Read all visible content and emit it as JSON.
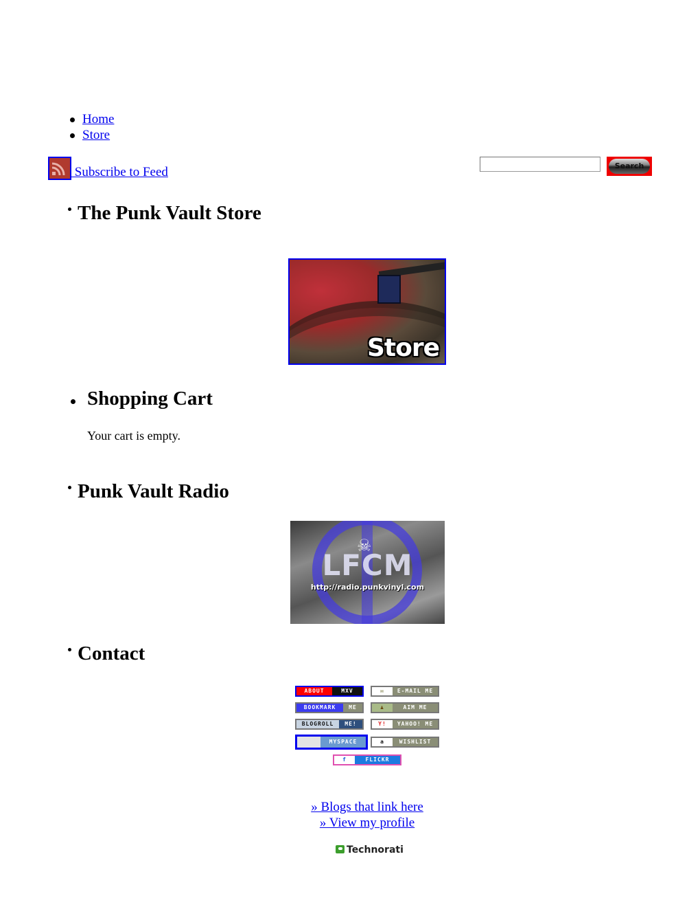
{
  "nav": {
    "items": [
      {
        "label": "Home"
      },
      {
        "label": "Store"
      }
    ]
  },
  "feed": {
    "icon": "rss-feed-icon",
    "label": " Subscribe to Feed"
  },
  "search": {
    "value": "",
    "placeholder": "",
    "button_label": "Search",
    "button_color": "#e00000"
  },
  "sections": {
    "store": {
      "title": "The Punk Vault Store",
      "image_alt": "Store",
      "image_caption": "Store"
    },
    "cart": {
      "title": "Shopping Cart",
      "message": "Your cart is empty."
    },
    "radio": {
      "title": "Punk Vault Radio",
      "image_alt": "LFCM http://radio.punkvinyl.com",
      "image_title": "LFCM",
      "image_url_text": "http://radio.punkvinyl.com"
    },
    "contact": {
      "title": "Contact",
      "badges": [
        {
          "left": "ABOUT",
          "right": "MXV",
          "left_bg": "#ff0000",
          "left_fg": "#ffffff",
          "right_bg": "#111111",
          "right_fg": "#ffffff"
        },
        {
          "left": "✉",
          "right": "E-MAIL ME",
          "left_bg": "#ffffff",
          "left_fg": "#6b6b2a",
          "right_bg": "#8a8e76",
          "right_fg": "#ffffff"
        },
        {
          "left": "BOOKMARK",
          "right": "ME",
          "left_bg": "#3b3bf0",
          "left_fg": "#ffffff",
          "right_bg": "#8a8e76",
          "right_fg": "#ffffff"
        },
        {
          "left": "♟",
          "right": "AIM ME",
          "left_bg": "#a9bb88",
          "left_fg": "#6b4a10",
          "right_bg": "#8a8e76",
          "right_fg": "#ffffff"
        },
        {
          "left": "BLOGROLL",
          "right": "ME!",
          "left_bg": "#c8d4e2",
          "left_fg": "#111111",
          "right_bg": "#2e4f7d",
          "right_fg": "#ffffff"
        },
        {
          "left": "Y!",
          "right": "YAHOO! ME",
          "left_bg": "#ffffff",
          "left_fg": "#dd2222",
          "right_bg": "#8a8e76",
          "right_fg": "#ffffff"
        },
        {
          "left": "",
          "right": "MYSPACE",
          "left_bg": "#e4e4e4",
          "left_fg": "#111111",
          "right_bg": "#6a9ad0",
          "right_fg": "#ffffff"
        },
        {
          "left": "a",
          "right": "WISHLIST",
          "left_bg": "#ffffff",
          "left_fg": "#111111",
          "right_bg": "#8a8e76",
          "right_fg": "#ffffff"
        },
        {
          "left": "f",
          "right": "FLICKR",
          "left_bg": "#ffffff",
          "left_fg": "#1c5fd6",
          "right_bg": "#1c7ae0",
          "right_fg": "#ffffff"
        }
      ]
    }
  },
  "technorati": {
    "links": [
      {
        "label": "» Blogs that link here"
      },
      {
        "label": "» View my profile"
      }
    ],
    "logo_text": "Technorati"
  }
}
